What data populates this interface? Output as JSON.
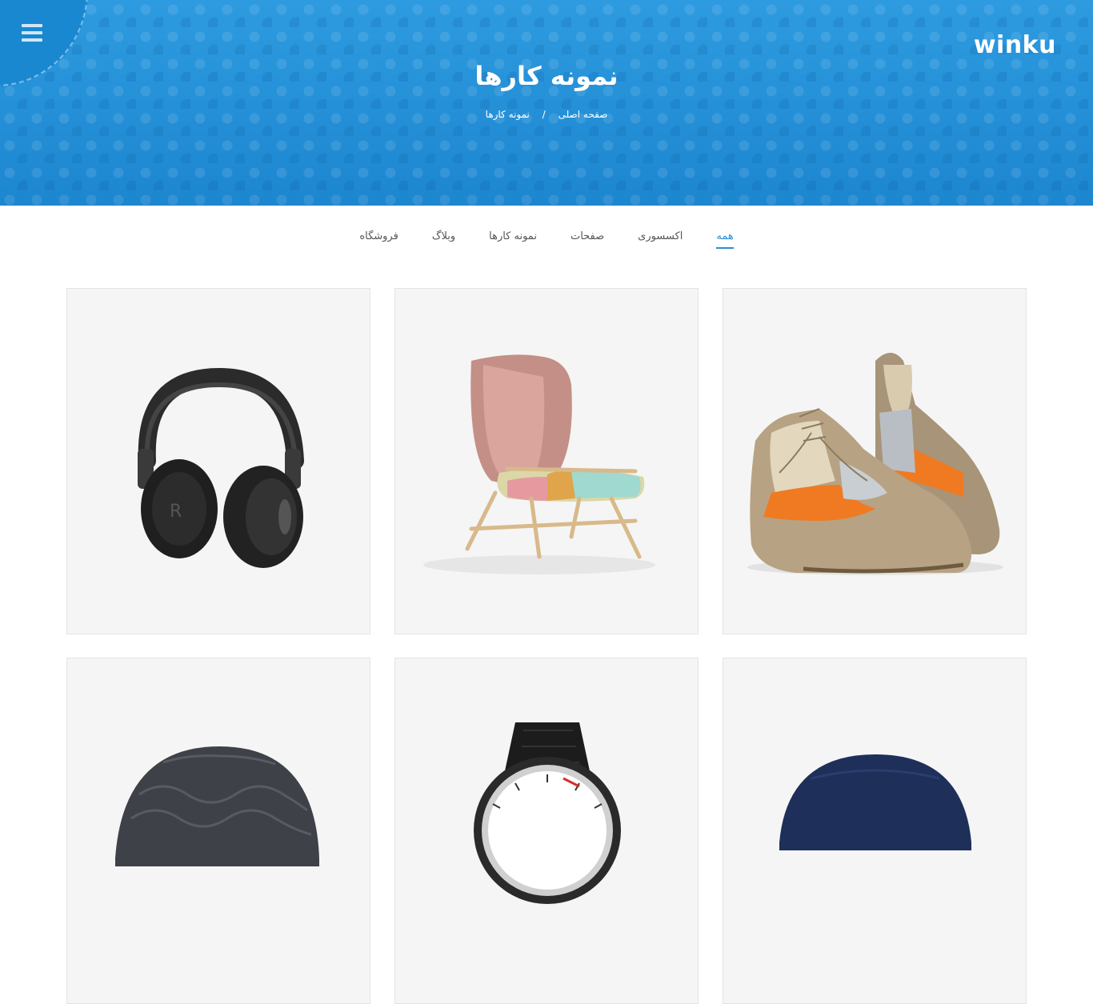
{
  "header": {
    "logo_text": "winku",
    "page_title": "نمونه کارها",
    "breadcrumb": {
      "home": "صفحه اصلی",
      "separator": "/",
      "current": "نمونه کارها"
    }
  },
  "filters": [
    {
      "label": "همه",
      "active": true
    },
    {
      "label": "اکسسوری",
      "active": false
    },
    {
      "label": "صفحات",
      "active": false
    },
    {
      "label": "نمونه کارها",
      "active": false
    },
    {
      "label": "وبلاگ",
      "active": false
    },
    {
      "label": "فروشگاه",
      "active": false
    }
  ],
  "portfolio": [
    {
      "item": "shoes-image"
    },
    {
      "item": "chair-image"
    },
    {
      "item": "headphones-image"
    },
    {
      "item": "beanie-blue-image"
    },
    {
      "item": "watch-image"
    },
    {
      "item": "beanie-gray-image"
    }
  ],
  "colors": {
    "accent": "#2a8fd6",
    "hero": "#1f8fd6"
  }
}
